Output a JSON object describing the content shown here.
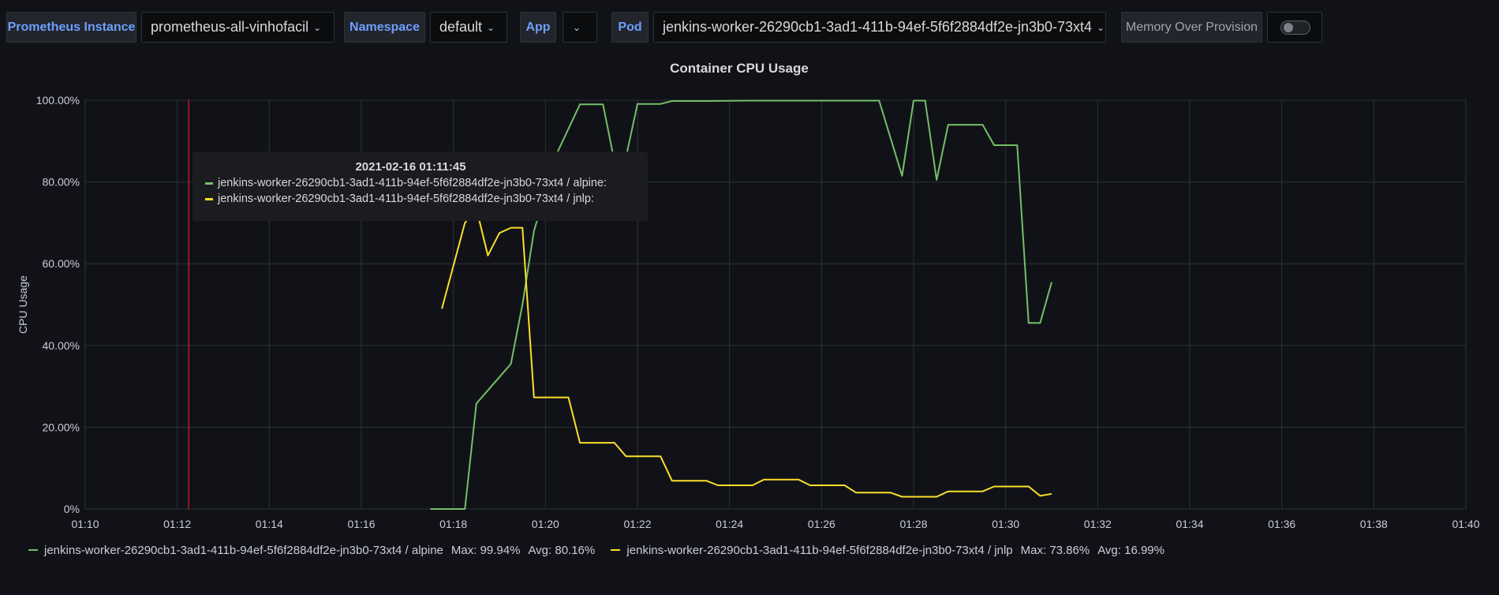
{
  "variables": [
    {
      "label": "Prometheus Instance",
      "value": "prometheus-all-vinhofacil"
    },
    {
      "label": "Namespace",
      "value": "default"
    },
    {
      "label": "App",
      "value": ""
    },
    {
      "label": "Pod",
      "value": "jenkins-worker-26290cb1-3ad1-411b-94ef-5f6f2884df2e-jn3b0-73xt4"
    },
    {
      "label": "Memory Over Provision",
      "toggle": false
    }
  ],
  "icons": {
    "dropdown": "chevron-down-icon",
    "toggle": "toggle-switch"
  },
  "tooltip": {
    "time": "2021-02-16 01:11:45",
    "rows": [
      "jenkins-worker-26290cb1-3ad1-411b-94ef-5f6f2884df2e-jn3b0-73xt4 / alpine:",
      "jenkins-worker-26290cb1-3ad1-411b-94ef-5f6f2884df2e-jn3b0-73xt4 / jnlp:"
    ]
  },
  "legend_stats": [
    {
      "max": "Max: 99.94%",
      "avg": "Avg: 80.16%"
    },
    {
      "max": "Max: 73.86%",
      "avg": "Avg: 16.99%"
    }
  ],
  "chart_data": {
    "type": "line",
    "title": "Container CPU Usage",
    "xlabel": "",
    "ylabel": "CPU Usage",
    "x_unit": "time",
    "xlim": [
      "01:10",
      "01:40"
    ],
    "ylim": [
      0,
      100
    ],
    "x_ticks": [
      "01:10",
      "01:12",
      "01:14",
      "01:16",
      "01:18",
      "01:20",
      "01:22",
      "01:24",
      "01:26",
      "01:28",
      "01:30",
      "01:32",
      "01:34",
      "01:36",
      "01:38",
      "01:40"
    ],
    "y_ticks": [
      "0%",
      "20.00%",
      "40.00%",
      "60.00%",
      "80.00%",
      "100.00%"
    ],
    "grid": true,
    "legend_position": "bottom",
    "cursor_time": "01:12:15",
    "colors": {
      "cursor": "#c4162a",
      "grid": "#2c3235",
      "axis_text": "#ccccdc"
    },
    "series": [
      {
        "name": "jenkins-worker-26290cb1-3ad1-411b-94ef-5f6f2884df2e-jn3b0-73xt4 / alpine",
        "color": "#73bf69",
        "points": [
          [
            "01:17:30",
            0
          ],
          [
            "01:18:15",
            0
          ],
          [
            "01:18:30",
            25.8
          ],
          [
            "01:19:15",
            35.5
          ],
          [
            "01:19:30",
            50
          ],
          [
            "01:19:45",
            68
          ],
          [
            "01:20:15",
            87
          ],
          [
            "01:20:30",
            93
          ],
          [
            "01:20:45",
            99
          ],
          [
            "01:21:15",
            99
          ],
          [
            "01:21:30",
            85
          ],
          [
            "01:21:45",
            86
          ],
          [
            "01:22:00",
            99.1
          ],
          [
            "01:22:30",
            99.1
          ],
          [
            "01:22:45",
            99.8
          ],
          [
            "01:23:30",
            99.8
          ],
          [
            "01:24:30",
            99.9
          ],
          [
            "01:25:45",
            99.9
          ],
          [
            "01:26:30",
            99.9
          ],
          [
            "01:27:15",
            99.9
          ],
          [
            "01:27:45",
            81.5
          ],
          [
            "01:28:00",
            99.9
          ],
          [
            "01:28:15",
            99.9
          ],
          [
            "01:28:30",
            80.5
          ],
          [
            "01:28:45",
            94
          ],
          [
            "01:29:30",
            94
          ],
          [
            "01:29:45",
            89
          ],
          [
            "01:30:15",
            89
          ],
          [
            "01:30:30",
            45.5
          ],
          [
            "01:30:45",
            45.5
          ],
          [
            "01:31:00",
            55.5
          ]
        ]
      },
      {
        "name": "jenkins-worker-26290cb1-3ad1-411b-94ef-5f6f2884df2e-jn3b0-73xt4 / jnlp",
        "color": "#fade2a",
        "points": [
          [
            "01:17:45",
            49
          ],
          [
            "01:18:15",
            70
          ],
          [
            "01:18:30",
            73.5
          ],
          [
            "01:18:45",
            62
          ],
          [
            "01:19:00",
            67.5
          ],
          [
            "01:19:15",
            68.8
          ],
          [
            "01:19:30",
            68.8
          ],
          [
            "01:19:45",
            27.3
          ],
          [
            "01:20:30",
            27.3
          ],
          [
            "01:20:45",
            16.2
          ],
          [
            "01:21:30",
            16.2
          ],
          [
            "01:21:45",
            12.9
          ],
          [
            "01:22:30",
            12.9
          ],
          [
            "01:22:45",
            6.9
          ],
          [
            "01:23:30",
            6.9
          ],
          [
            "01:23:45",
            5.8
          ],
          [
            "01:24:30",
            5.8
          ],
          [
            "01:24:45",
            7.2
          ],
          [
            "01:25:30",
            7.2
          ],
          [
            "01:25:45",
            5.8
          ],
          [
            "01:26:30",
            5.8
          ],
          [
            "01:26:45",
            4.0
          ],
          [
            "01:27:30",
            4.0
          ],
          [
            "01:27:45",
            3.0
          ],
          [
            "01:28:30",
            3.0
          ],
          [
            "01:28:45",
            4.3
          ],
          [
            "01:29:30",
            4.3
          ],
          [
            "01:29:45",
            5.5
          ],
          [
            "01:30:30",
            5.5
          ],
          [
            "01:30:45",
            3.2
          ],
          [
            "01:31:00",
            3.7
          ]
        ]
      }
    ]
  }
}
